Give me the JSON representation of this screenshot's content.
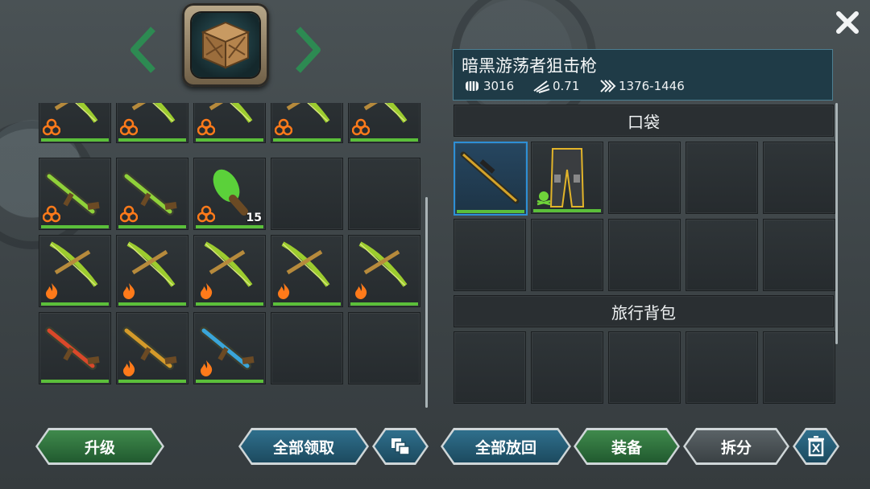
{
  "chest": {
    "icon": "wooden-crate-icon"
  },
  "inventory": {
    "cells": [
      {
        "item": "green-bow",
        "badge": "biohazard",
        "qty": ""
      },
      {
        "item": "green-bow",
        "badge": "biohazard",
        "qty": ""
      },
      {
        "item": "green-bow",
        "badge": "biohazard",
        "qty": ""
      },
      {
        "item": "green-bow",
        "badge": "biohazard",
        "qty": ""
      },
      {
        "item": "green-bow",
        "badge": "biohazard",
        "qty": ""
      },
      {
        "item": "green-rifle",
        "badge": "biohazard",
        "qty": ""
      },
      {
        "item": "green-rifle",
        "badge": "biohazard",
        "qty": ""
      },
      {
        "item": "green-grenade",
        "badge": "biohazard",
        "qty": "15"
      },
      {
        "item": "",
        "badge": "",
        "qty": ""
      },
      {
        "item": "",
        "badge": "",
        "qty": ""
      },
      {
        "item": "green-bow",
        "badge": "fire",
        "qty": ""
      },
      {
        "item": "green-bow",
        "badge": "fire",
        "qty": ""
      },
      {
        "item": "green-bow",
        "badge": "fire",
        "qty": ""
      },
      {
        "item": "green-bow",
        "badge": "fire",
        "qty": ""
      },
      {
        "item": "green-bow",
        "badge": "fire",
        "qty": ""
      },
      {
        "item": "red-rifle",
        "badge": "",
        "qty": ""
      },
      {
        "item": "gold-rifle",
        "badge": "fire",
        "qty": ""
      },
      {
        "item": "blue-rifle",
        "badge": "fire",
        "qty": ""
      },
      {
        "item": "",
        "badge": "",
        "qty": ""
      },
      {
        "item": "",
        "badge": "",
        "qty": ""
      }
    ]
  },
  "detail": {
    "title": "暗黑游荡者狙击枪",
    "damage": "3016",
    "speed": "0.71",
    "range": "1376-1446"
  },
  "sections": {
    "pocket": "口袋",
    "backpack": "旅行背包"
  },
  "pocket_items": [
    {
      "item": "sniper-rifle",
      "selected": true
    },
    {
      "item": "armored-pants",
      "selected": false
    }
  ],
  "buttons": {
    "upgrade": "升级",
    "claim_all": "全部领取",
    "return_all": "全部放回",
    "equip": "装备",
    "disassemble": "拆分"
  },
  "colors": {
    "green_bar": "#5bbf3a",
    "selected_border": "#2d8fd6",
    "badge_orange": "#ff7a1a"
  }
}
